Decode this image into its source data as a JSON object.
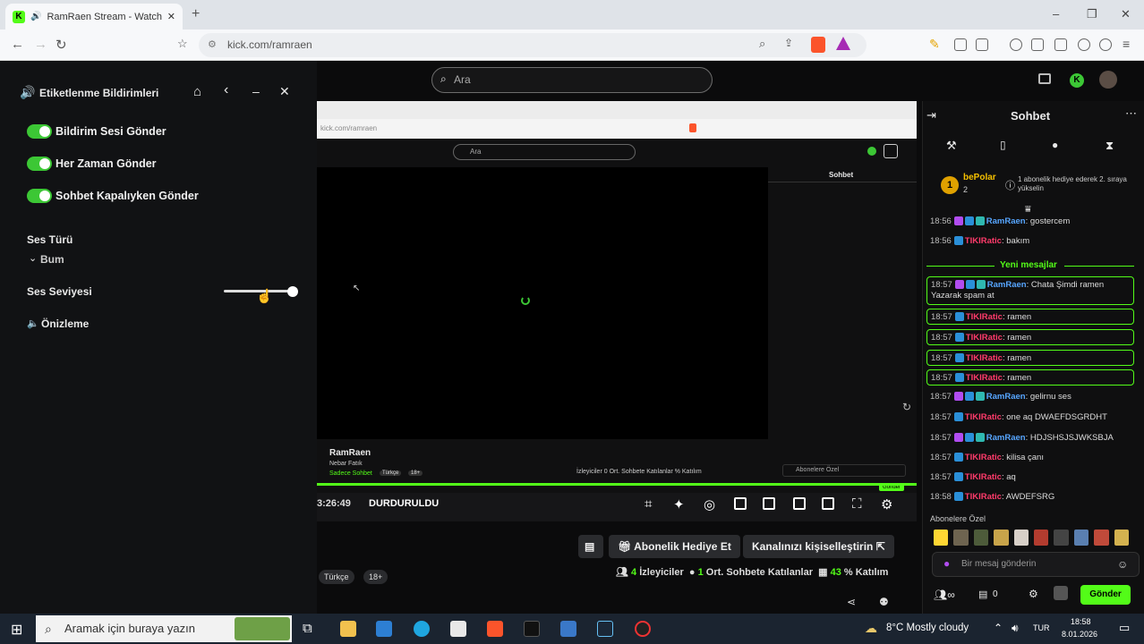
{
  "browser": {
    "tab_title": "RamRaen Stream - Watch Liv",
    "url": "kick.com/ramraen",
    "new_tab": "+",
    "win_min": "–",
    "win_max": "❐",
    "win_close": "✕"
  },
  "notif_panel": {
    "title": "Etiketlenme Bildirimleri",
    "toggles": [
      {
        "label": "Bildirim Sesi Gönder",
        "on": true
      },
      {
        "label": "Her Zaman Gönder",
        "on": true
      },
      {
        "label": "Sohbet Kapalıyken Gönder",
        "on": true
      }
    ],
    "sound_type_label": "Ses Türü",
    "sound_type_value": "Bum",
    "volume_label": "Ses Seviyesi",
    "volume_level": 1.0,
    "preview_label": "Önizleme"
  },
  "search": {
    "placeholder": "Ara"
  },
  "inner": {
    "search": "Ara",
    "chat_title": "Sohbet",
    "url": "kick.com/ramraen",
    "streamer": "RamRaen",
    "category": "Nebar Fatık",
    "tag1": "Sadece Sohbet",
    "tag2": "Türkçe",
    "tag3": "18+",
    "stats": "İzleyiciler  0 Ort. Sohbete Katılanlar  % Katılım",
    "subs_only": "Abonelere Özel",
    "send": "Gönder"
  },
  "stream_bar": {
    "time": "3:26:49",
    "status": "DURDURULDU"
  },
  "stream_actions": {
    "gift_sub": "Abonelik Hediye Et",
    "customize": "Kanalınızı kişiselleştirin"
  },
  "channel_tags": [
    "Türkçe",
    "18+"
  ],
  "channel_stats": {
    "viewers_count": "4",
    "viewers_label": "İzleyiciler",
    "avg_chatters_count": "1",
    "avg_chatters_label": "Ort. Sohbete Katılanlar",
    "participation_value": "43",
    "participation_label": "% Katılım"
  },
  "chat": {
    "title": "Sohbet",
    "leader_rank": "1",
    "leader_name": "bePolar",
    "leader_count": "2",
    "promo": "1 abonelik hediye ederek 2. sıraya yükselin",
    "new_messages": "Yeni mesajlar",
    "messages": [
      {
        "time": "18:56",
        "user": "RamRaen",
        "text": "gostercem",
        "color": "blue",
        "highlight": false
      },
      {
        "time": "18:56",
        "user": "TIKIRatic",
        "text": "bakım",
        "color": "red",
        "highlight": false
      },
      {
        "time": "18:57",
        "user": "RamRaen",
        "text": "Chata Şimdi ramen Yazarak spam at",
        "color": "blue",
        "highlight": true
      },
      {
        "time": "18:57",
        "user": "TIKIRatic",
        "text": "ramen",
        "color": "red",
        "highlight": true
      },
      {
        "time": "18:57",
        "user": "TIKIRatic",
        "text": "ramen",
        "color": "red",
        "highlight": true
      },
      {
        "time": "18:57",
        "user": "TIKIRatic",
        "text": "ramen",
        "color": "red",
        "highlight": true
      },
      {
        "time": "18:57",
        "user": "TIKIRatic",
        "text": "ramen",
        "color": "red",
        "highlight": true
      },
      {
        "time": "18:57",
        "user": "RamRaen",
        "text": "gelirnu ses",
        "color": "blue",
        "highlight": false
      },
      {
        "time": "18:57",
        "user": "TIKIRatic",
        "text": "one aq DWAEFDSGRDHT",
        "color": "red",
        "highlight": false
      },
      {
        "time": "18:57",
        "user": "RamRaen",
        "text": "HDJSHSJSJWKSBJA",
        "color": "blue",
        "highlight": false
      },
      {
        "time": "18:57",
        "user": "TIKIRatic",
        "text": "kilisa çanı",
        "color": "red",
        "highlight": false
      },
      {
        "time": "18:57",
        "user": "TIKIRatic",
        "text": "aq",
        "color": "red",
        "highlight": false
      },
      {
        "time": "18:58",
        "user": "TIKIRatic",
        "text": "AWDEFSRG",
        "color": "red",
        "highlight": false
      }
    ],
    "subs_only": "Abonelere Özel",
    "input_placeholder": "Bir mesaj gönderin",
    "send": "Gönder",
    "footer_count1": "0"
  },
  "taskbar": {
    "search_placeholder": "Aramak için buraya yazın",
    "weather": "8°C  Mostly cloudy",
    "lang": "TUR",
    "time": "18:58",
    "date": "8.01.2026"
  }
}
